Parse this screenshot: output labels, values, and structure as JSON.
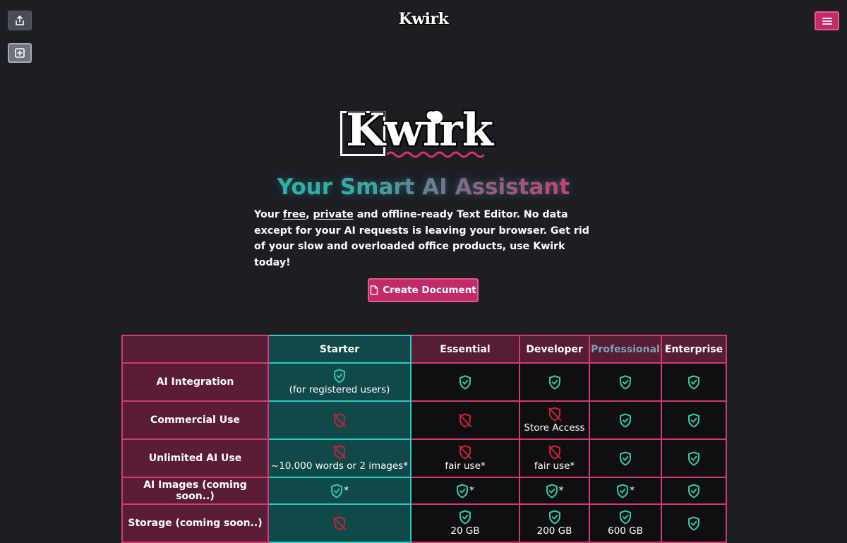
{
  "header": {
    "logo_text": "Kwirk",
    "share_icon": "share-icon",
    "new_icon": "plus-square-icon",
    "menu_icon": "hamburger-menu-icon"
  },
  "hero": {
    "logo_text": "Kwirk",
    "tagline": "Your Smart AI Assistant",
    "intro": {
      "part1": "Your ",
      "free": "free",
      "comma": ", ",
      "private": "private",
      "part2": " and offline-ready Text Editor. No data except for your AI requests is leaving your browser. Get rid of your slow and overloaded office products, use Kwirk today!"
    },
    "cta_label": "Create Document",
    "cta_icon": "document-icon"
  },
  "colors": {
    "background": "#1c1e24",
    "accent_pink": "#c12c67",
    "teal": "#2ec9bf",
    "check_green": "#36c7a6",
    "cross_red": "#c8203c"
  },
  "table": {
    "headers": [
      "",
      "Starter",
      "Essential",
      "Developer",
      "Professional",
      "Enterprise"
    ],
    "rows": [
      {
        "label": "AI Integration",
        "cells": [
          {
            "icon": "check",
            "note": "(for registered users)"
          },
          {
            "icon": "check"
          },
          {
            "icon": "check"
          },
          {
            "icon": "check"
          },
          {
            "icon": "check"
          }
        ]
      },
      {
        "label": "Commercial Use",
        "cells": [
          {
            "icon": "cross"
          },
          {
            "icon": "cross"
          },
          {
            "icon": "cross",
            "note": "Store Access"
          },
          {
            "icon": "check"
          },
          {
            "icon": "check"
          }
        ]
      },
      {
        "label": "Unlimited AI Use",
        "cells": [
          {
            "icon": "cross",
            "note": "~10.000 words or 2 images*"
          },
          {
            "icon": "cross",
            "note": "fair use*"
          },
          {
            "icon": "cross",
            "note": "fair use*"
          },
          {
            "icon": "check"
          },
          {
            "icon": "check"
          }
        ]
      },
      {
        "label": "AI Images (coming soon..)",
        "cells": [
          {
            "icon": "check",
            "suffix": "*"
          },
          {
            "icon": "check",
            "suffix": "*"
          },
          {
            "icon": "check",
            "suffix": "*"
          },
          {
            "icon": "check",
            "suffix": "*"
          },
          {
            "icon": "check"
          }
        ]
      },
      {
        "label": "Storage (coming soon..)",
        "cells": [
          {
            "icon": "cross"
          },
          {
            "icon": "check",
            "note": "20 GB"
          },
          {
            "icon": "check",
            "note": "200 GB"
          },
          {
            "icon": "check",
            "note": "600 GB"
          },
          {
            "icon": "check"
          }
        ]
      }
    ]
  }
}
